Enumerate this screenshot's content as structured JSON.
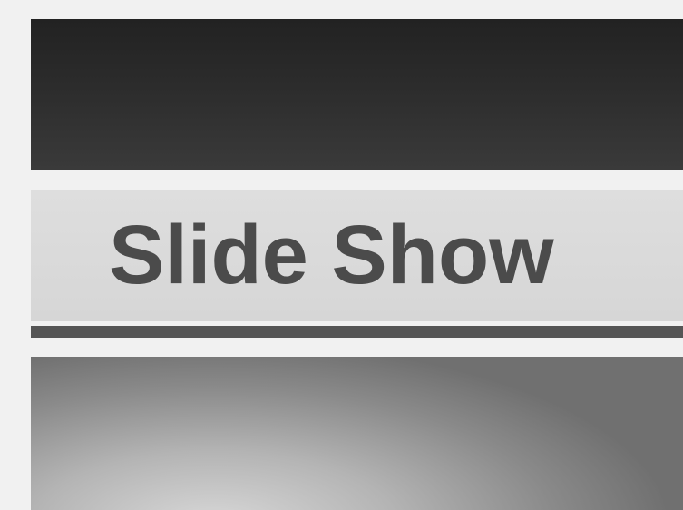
{
  "menu": {
    "selected_item_label": "Slide Show"
  }
}
